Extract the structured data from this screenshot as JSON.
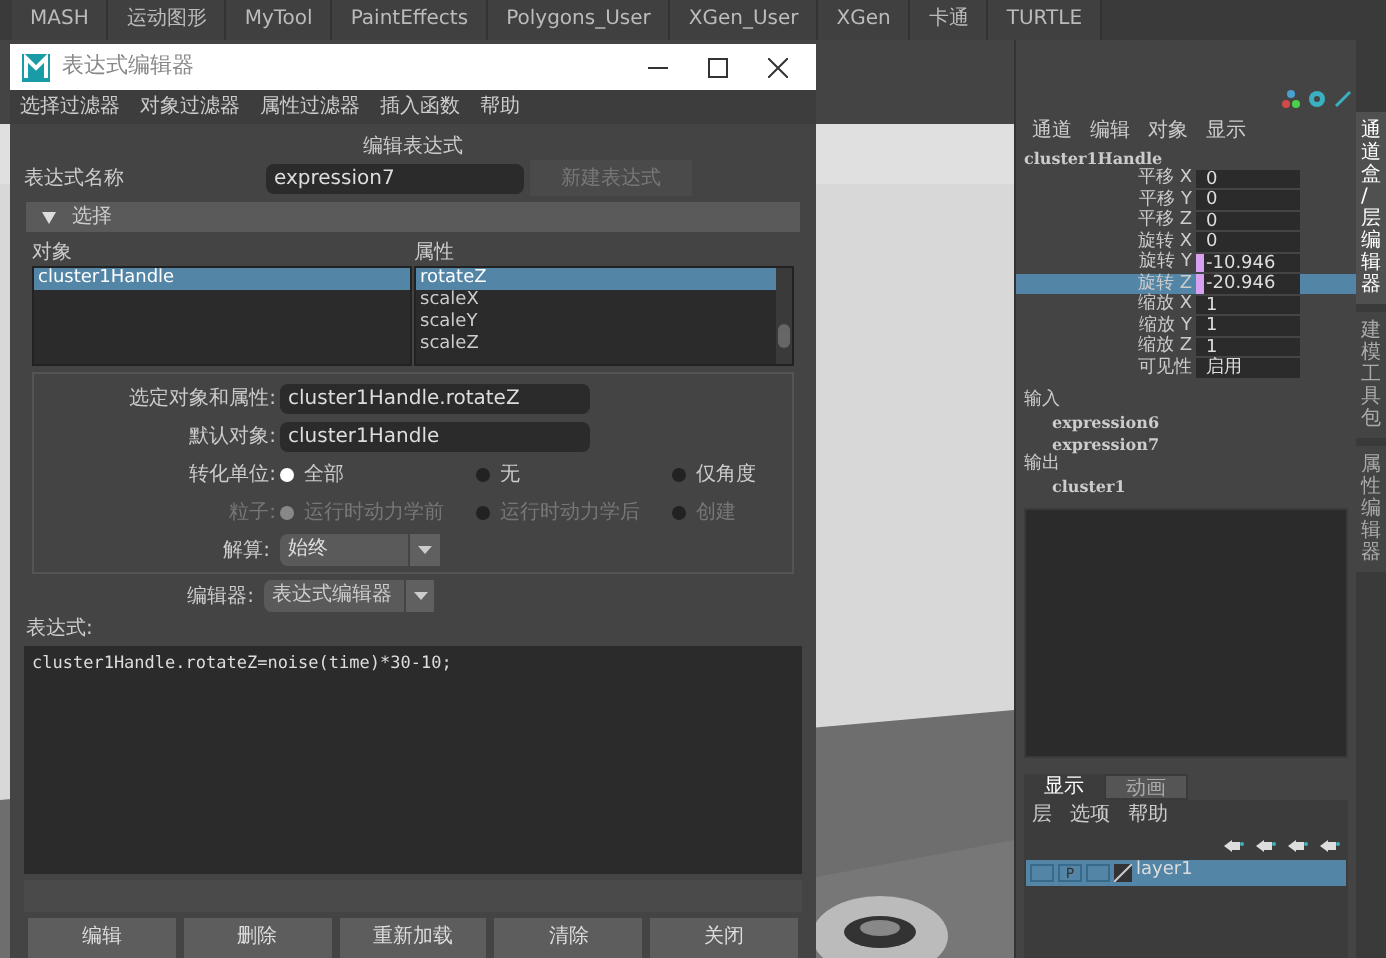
{
  "shelf_tabs": [
    "MASH",
    "运动图形",
    "MyTool",
    "PaintEffects",
    "Polygons_User",
    "XGen_User",
    "XGen",
    "卡通",
    "TURTLE"
  ],
  "dialog": {
    "title": "表达式编辑器",
    "menu": [
      "选择过滤器",
      "对象过滤器",
      "属性过滤器",
      "插入函数",
      "帮助"
    ],
    "heading": "编辑表达式",
    "name_label": "表达式名称",
    "name_value": "expression7",
    "new_button": {
      "label": "新建表达式",
      "disabled": true
    },
    "section": {
      "label": "选择",
      "expanded": true
    },
    "objects": {
      "label": "对象",
      "items": [
        {
          "text": "cluster1Handle",
          "selected": true
        }
      ]
    },
    "attributes": {
      "label": "属性",
      "items": [
        {
          "text": "rotateZ",
          "selected": true
        },
        {
          "text": "scaleX",
          "selected": false
        },
        {
          "text": "scaleY",
          "selected": false
        },
        {
          "text": "scaleZ",
          "selected": false
        }
      ]
    },
    "selected_attr": {
      "label": "选定对象和属性:",
      "value": "cluster1Handle.rotateZ"
    },
    "default_object": {
      "label": "默认对象:",
      "value": "cluster1Handle"
    },
    "radio_groups": [
      {
        "label": "转化单位:",
        "disabled": false,
        "options": [
          {
            "label": "全部",
            "selected": true
          },
          {
            "label": "无",
            "selected": false
          },
          {
            "label": "仅角度",
            "selected": false
          }
        ]
      },
      {
        "label": "粒子:",
        "disabled": true,
        "options": [
          {
            "label": "运行时动力学前",
            "selected": true
          },
          {
            "label": "运行时动力学后",
            "selected": false
          },
          {
            "label": "创建",
            "selected": false
          }
        ]
      }
    ],
    "evaluation": {
      "label": "解算:",
      "value": "始终"
    },
    "editor": {
      "label": "编辑器:",
      "value": "表达式编辑器"
    },
    "expression_label": "表达式:",
    "expression": "cluster1Handle.rotateZ=noise(time)*30-10;",
    "buttons": [
      "编辑",
      "删除",
      "重新加载",
      "清除",
      "关闭"
    ]
  },
  "channel_box": {
    "menu": [
      "通道",
      "编辑",
      "对象",
      "显示"
    ],
    "node": "cluster1Handle",
    "channels": [
      {
        "name": "平移 X",
        "value": "0",
        "keyed": false,
        "selected": false
      },
      {
        "name": "平移 Y",
        "value": "0",
        "keyed": false,
        "selected": false
      },
      {
        "name": "平移 Z",
        "value": "0",
        "keyed": false,
        "selected": false
      },
      {
        "name": "旋转 X",
        "value": "0",
        "keyed": false,
        "selected": false
      },
      {
        "name": "旋转 Y",
        "value": "-10.946",
        "keyed": true,
        "selected": false
      },
      {
        "name": "旋转 Z",
        "value": "-20.946",
        "keyed": true,
        "selected": true
      },
      {
        "name": "缩放 X",
        "value": "1",
        "keyed": false,
        "selected": false
      },
      {
        "name": "缩放 Y",
        "value": "1",
        "keyed": false,
        "selected": false
      },
      {
        "name": "缩放 Z",
        "value": "1",
        "keyed": false,
        "selected": false
      },
      {
        "name": "可见性",
        "value": "启用",
        "keyed": false,
        "selected": false
      }
    ],
    "inputs_label": "输入",
    "inputs": [
      "expression6",
      "expression7"
    ],
    "outputs_label": "输出",
    "outputs": [
      "cluster1"
    ]
  },
  "layer_editor": {
    "tabs": [
      {
        "label": "显示",
        "selected": true
      },
      {
        "label": "动画",
        "selected": false
      }
    ],
    "menu": [
      "层",
      "选项",
      "帮助"
    ],
    "layers": [
      {
        "name": "layer1",
        "playback": "P",
        "selected": true
      }
    ]
  },
  "side_tabs": [
    {
      "label": "通道盒/层编辑器",
      "selected": true
    },
    {
      "label": "建模工具包",
      "selected": false
    },
    {
      "label": "属性编辑器",
      "selected": false
    }
  ]
}
